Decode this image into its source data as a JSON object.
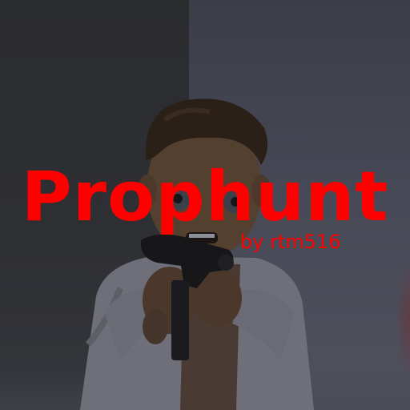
{
  "screen": {
    "title": "Prophunt",
    "subtitle": "by rtm516"
  },
  "colors": {
    "title_text": "#ff0000",
    "background_wall": "#2e2f33"
  }
}
